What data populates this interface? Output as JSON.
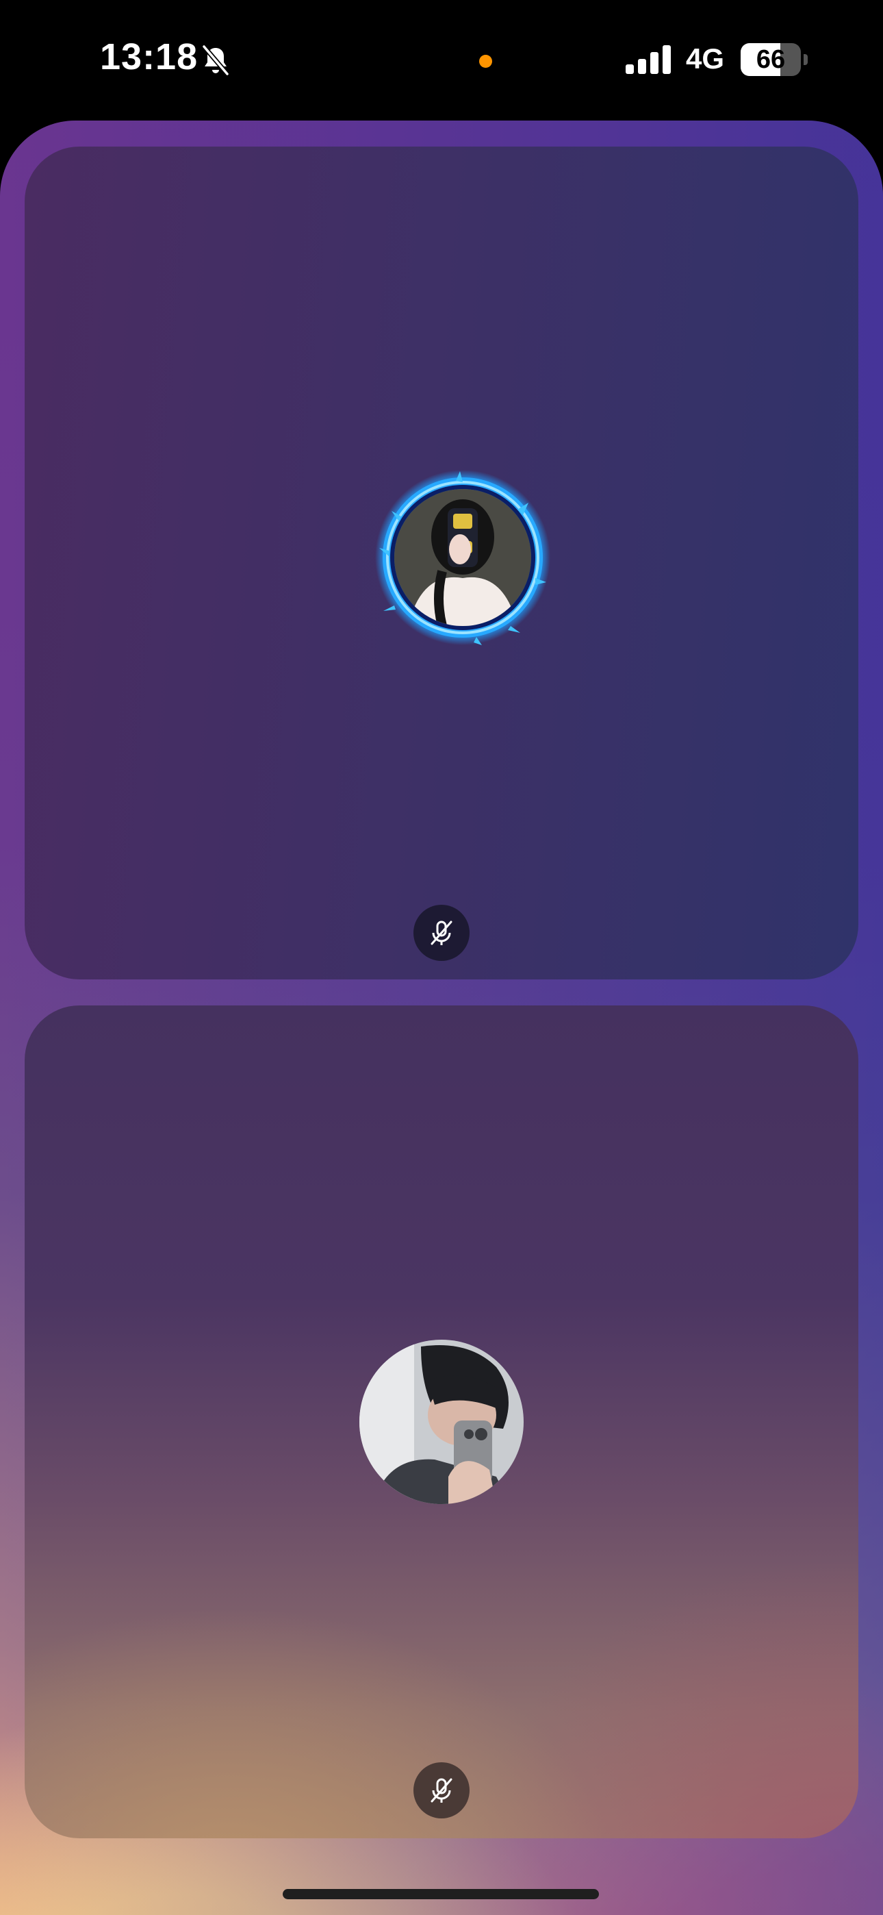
{
  "status_bar": {
    "time": "13:18",
    "network": "4G",
    "battery_level": "66",
    "battery_fraction": 0.66,
    "icons": [
      "bell-slash-icon",
      "cellular-signal-icon",
      "battery-icon"
    ],
    "privacy_indicator_color": "#ff9500"
  },
  "call": {
    "participants": [
      {
        "position": "top",
        "avatar_icon": "avatar-with-blue-fire-frame",
        "mic_state_icon": "microphone-slash-icon"
      },
      {
        "position": "bottom",
        "avatar_icon": "avatar-photo",
        "mic_state_icon": "microphone-slash-icon"
      }
    ]
  },
  "colors": {
    "frame_gradient_top_left": "#6a3590",
    "frame_gradient_top_right": "#2f3a9a",
    "frame_gradient_bottom_left": "#f2c98c",
    "frame_gradient_bottom_right": "#e06a7a",
    "fire_ring": "#33b8ff"
  }
}
